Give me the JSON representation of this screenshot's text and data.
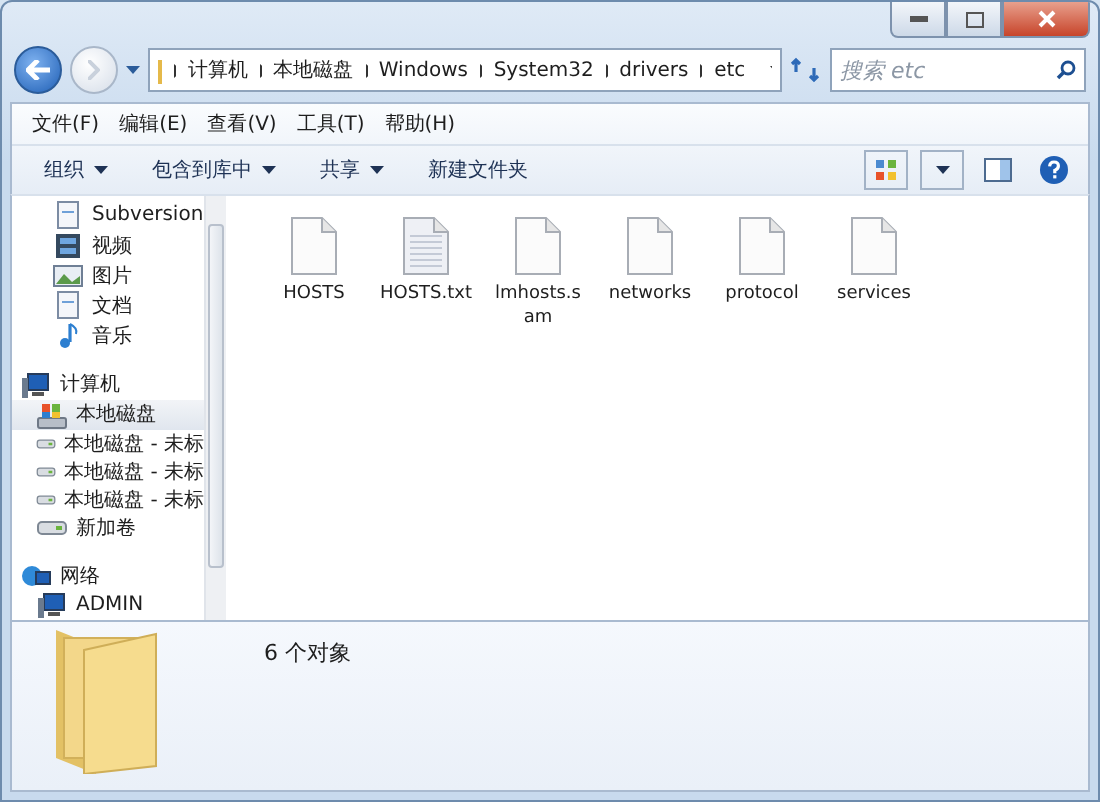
{
  "address": {
    "crumbs": [
      "计算机",
      "本地磁盘",
      "Windows",
      "System32",
      "drivers",
      "etc"
    ]
  },
  "search": {
    "placeholder": "搜索 etc"
  },
  "menu": [
    "文件(F)",
    "编辑(E)",
    "查看(V)",
    "工具(T)",
    "帮助(H)"
  ],
  "toolbar": [
    {
      "label": "组织",
      "dropdown": true
    },
    {
      "label": "包含到库中",
      "dropdown": true
    },
    {
      "label": "共享",
      "dropdown": true
    },
    {
      "label": "新建文件夹",
      "dropdown": false
    }
  ],
  "sidebar": [
    {
      "children": [
        {
          "label": "Subversion",
          "kind": "doc",
          "selected": false
        },
        {
          "label": "视频",
          "kind": "video",
          "selected": false
        },
        {
          "label": "图片",
          "kind": "picture",
          "selected": false
        },
        {
          "label": "文档",
          "kind": "doc",
          "selected": false
        },
        {
          "label": "音乐",
          "kind": "music",
          "selected": false
        }
      ]
    },
    {
      "label": "计算机",
      "kind": "computer",
      "children": [
        {
          "label": "本地磁盘",
          "kind": "system-drive",
          "selected": true
        },
        {
          "label": "本地磁盘 - 未标",
          "kind": "drive",
          "selected": false
        },
        {
          "label": "本地磁盘 - 未标",
          "kind": "drive",
          "selected": false
        },
        {
          "label": "本地磁盘 - 未标",
          "kind": "drive",
          "selected": false
        },
        {
          "label": "新加卷",
          "kind": "drive",
          "selected": false
        }
      ]
    },
    {
      "label": "网络",
      "kind": "network",
      "children": [
        {
          "label": "ADMIN",
          "kind": "computer",
          "selected": false
        }
      ]
    }
  ],
  "files": [
    {
      "name": "HOSTS",
      "kind": "file"
    },
    {
      "name": "HOSTS.txt",
      "kind": "text"
    },
    {
      "name": "lmhosts.sam",
      "kind": "file"
    },
    {
      "name": "networks",
      "kind": "file"
    },
    {
      "name": "protocol",
      "kind": "file"
    },
    {
      "name": "services",
      "kind": "file"
    }
  ],
  "status": {
    "count": "6 个对象"
  }
}
